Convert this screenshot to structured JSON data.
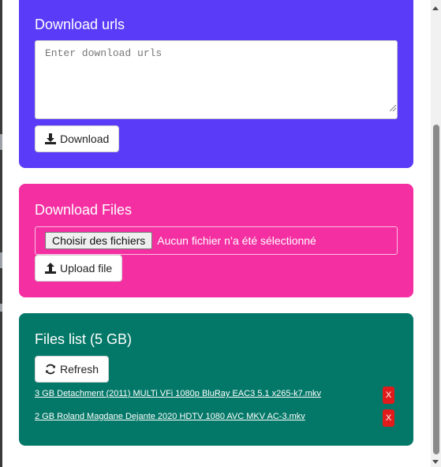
{
  "download_urls": {
    "title": "Download urls",
    "textarea_placeholder": "Enter download urls",
    "textarea_value": "",
    "button_label": "Download",
    "button_icon": "download-icon",
    "color": "#5a3cf8"
  },
  "download_files": {
    "title": "Download Files",
    "choose_button_label": "Choisir des fichiers",
    "file_status": "Aucun fichier n’a été sélectionné",
    "button_label": "Upload file",
    "button_icon": "upload-icon",
    "color": "#f42fa2"
  },
  "files_list": {
    "title": "Files list (5 GB)",
    "refresh_label": "Refresh",
    "refresh_icon": "refresh-icon",
    "color": "#047868",
    "files": [
      {
        "label": "3 GB Detachment (2011) MULTi VFi 1080p BluRay EAC3 5.1 x265-k7.mkv",
        "delete_label": "X"
      },
      {
        "label": "2 GB Roland Magdane Dejante 2020 HDTV 1080 AVC MKV AC-3.mkv",
        "delete_label": "X"
      }
    ],
    "delete_color": "#e11b1b"
  }
}
